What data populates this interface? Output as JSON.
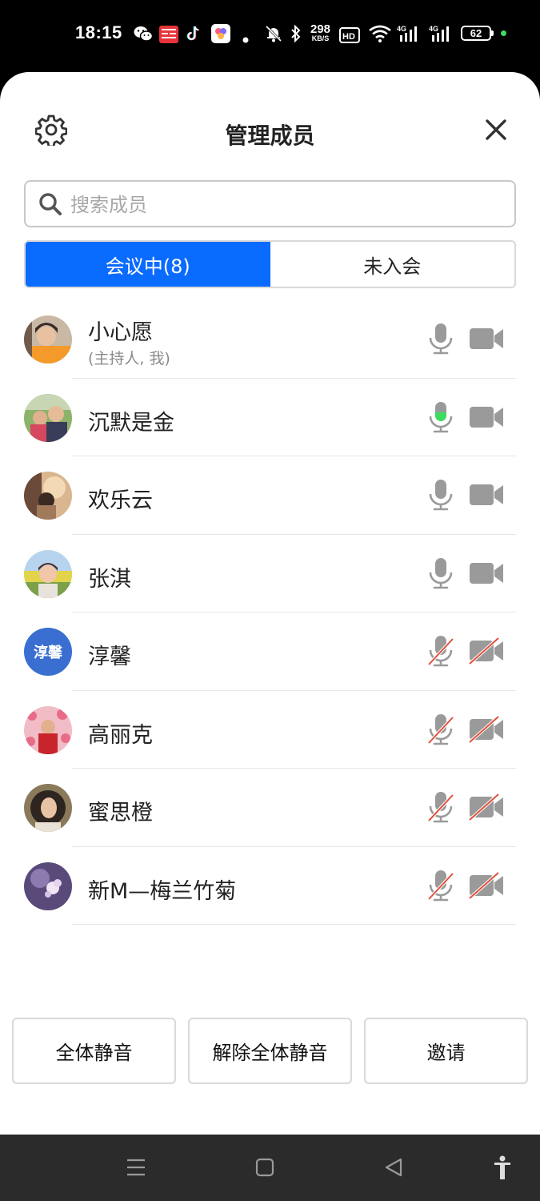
{
  "status_bar": {
    "time": "18:15",
    "net_speed_value": "298",
    "net_speed_unit": "KB/S",
    "battery": "62",
    "icons": [
      "wechat-icon",
      "toutiao-icon",
      "tiktok-icon",
      "app-icon",
      "dot-icon",
      "mute-bell-icon",
      "bluetooth-icon",
      "hd-icon",
      "wifi-icon",
      "signal-4g-icon",
      "signal-4g-icon",
      "battery-icon"
    ]
  },
  "header": {
    "title": "管理成员",
    "settings_icon": "gear-icon",
    "close_icon": "close-icon"
  },
  "search": {
    "placeholder": "搜索成员",
    "value": ""
  },
  "tabs": [
    {
      "label": "会议中(8)",
      "active": true
    },
    {
      "label": "未入会",
      "active": false
    }
  ],
  "members": [
    {
      "name": "小心愿",
      "role": "(主持人, 我)",
      "avatar": "photo",
      "mic": "on",
      "camera": "on"
    },
    {
      "name": "沉默是金",
      "role": "",
      "avatar": "photo",
      "mic": "speaking",
      "camera": "on"
    },
    {
      "name": "欢乐云",
      "role": "",
      "avatar": "photo",
      "mic": "on",
      "camera": "on"
    },
    {
      "name": "张淇",
      "role": "",
      "avatar": "photo",
      "mic": "on",
      "camera": "on"
    },
    {
      "name": "淳馨",
      "role": "",
      "avatar": "text",
      "avatar_text": "淳馨",
      "mic": "muted",
      "camera": "off"
    },
    {
      "name": "高丽克",
      "role": "",
      "avatar": "photo",
      "mic": "muted",
      "camera": "off"
    },
    {
      "name": "蜜思橙",
      "role": "",
      "avatar": "photo",
      "mic": "muted",
      "camera": "off"
    },
    {
      "name": "新M—梅兰竹菊",
      "role": "",
      "avatar": "photo",
      "mic": "muted",
      "camera": "off"
    }
  ],
  "actions": {
    "mute_all": "全体静音",
    "unmute_all": "解除全体静音",
    "invite": "邀请"
  },
  "colors": {
    "accent": "#0a6bff",
    "speaking": "#3ddc5f",
    "muted_slash": "#e0503c",
    "icon_gray": "#9a9a9a"
  },
  "nav_bar": [
    "menu-icon",
    "home-icon",
    "back-icon",
    "accessibility-icon"
  ]
}
